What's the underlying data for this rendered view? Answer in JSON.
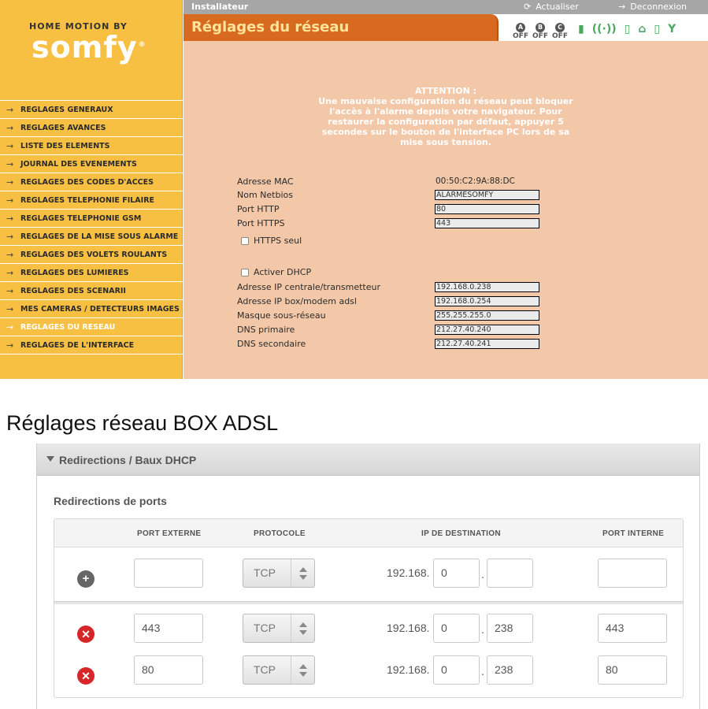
{
  "somfy": {
    "logo": {
      "top": "HOME MOTION BY",
      "brand": "somfy",
      "reg": "®"
    },
    "topbar": {
      "role": "Installateur",
      "refresh": "Actualiser",
      "logout": "Deconnexion"
    },
    "title": "Réglages du réseau",
    "zones": [
      {
        "letter": "A",
        "state": "OFF"
      },
      {
        "letter": "B",
        "state": "OFF"
      },
      {
        "letter": "C",
        "state": "OFF"
      }
    ],
    "status_icons": [
      "battery-icon",
      "radio-signal-icon",
      "phone-icon",
      "home-ok-icon",
      "gsm-icon",
      "antenna-icon"
    ],
    "menu": [
      "REGLAGES GENERAUX",
      "REGLAGES AVANCES",
      "LISTE DES ELEMENTS",
      "JOURNAL DES EVENEMENTS",
      "REGLAGES DES CODES D'ACCES",
      "REGLAGES TELEPHONIE FILAIRE",
      "REGLAGES TELEPHONIE GSM",
      "REGLAGES DE LA MISE SOUS ALARME",
      "REGLAGES DES VOLETS ROULANTS",
      "REGLAGES DES LUMIERES",
      "REGLAGES DES SCENARII",
      "MES CAMERAS / DETECTEURS IMAGES",
      "REGLAGES DU RESEAU",
      "REGLAGES DE L'INTERFACE"
    ],
    "active_menu_index": 12,
    "warning": {
      "title": "ATTENTION :",
      "lines": [
        "Une mauvaise configuration du réseau peut bloquer",
        "l'accès à l'alarme depuis votre navigateur. Pour",
        "restaurer la configuration par défaut, appuyer 5",
        "secondes sur le bouton de l'interface PC lors de sa",
        "mise sous tension."
      ]
    },
    "fields": {
      "mac_label": "Adresse MAC",
      "mac_value": "00:50:C2:9A:88:DC",
      "netbios_label": "Nom Netbios",
      "netbios_value": "ALARMESOMFY",
      "http_label": "Port HTTP",
      "http_value": "80",
      "https_label": "Port HTTPS",
      "https_value": "443",
      "https_only_label": "HTTPS seul",
      "dhcp_label": "Activer DHCP",
      "ip_central_label": "Adresse IP centrale/transmetteur",
      "ip_central_value": "192.168.0.238",
      "ip_box_label": "Adresse IP box/modem adsl",
      "ip_box_value": "192.168.0.254",
      "mask_label": "Masque sous-réseau",
      "mask_value": "255.255.255.0",
      "dns1_label": "DNS primaire",
      "dns1_value": "212.27.40.240",
      "dns2_label": "DNS secondaire",
      "dns2_value": "212.27.40.241"
    }
  },
  "heading": "Réglages réseau BOX ADSL",
  "box": {
    "panel_title": "Redirections / Baux DHCP",
    "subtitle": "Redirections de ports",
    "columns": {
      "external": "PORT EXTERNE",
      "protocol": "PROTOCOLE",
      "destination": "IP DE DESTINATION",
      "internal": "PORT INTERNE"
    },
    "ip_prefix": "192.168.",
    "dot": ".",
    "new_row": {
      "external": "",
      "protocol": "TCP",
      "ip3": "0",
      "ip4": "",
      "internal": ""
    },
    "rows": [
      {
        "external": "443",
        "protocol": "TCP",
        "ip3": "0",
        "ip4": "238",
        "internal": "443"
      },
      {
        "external": "80",
        "protocol": "TCP",
        "ip3": "0",
        "ip4": "238",
        "internal": "80"
      }
    ]
  }
}
